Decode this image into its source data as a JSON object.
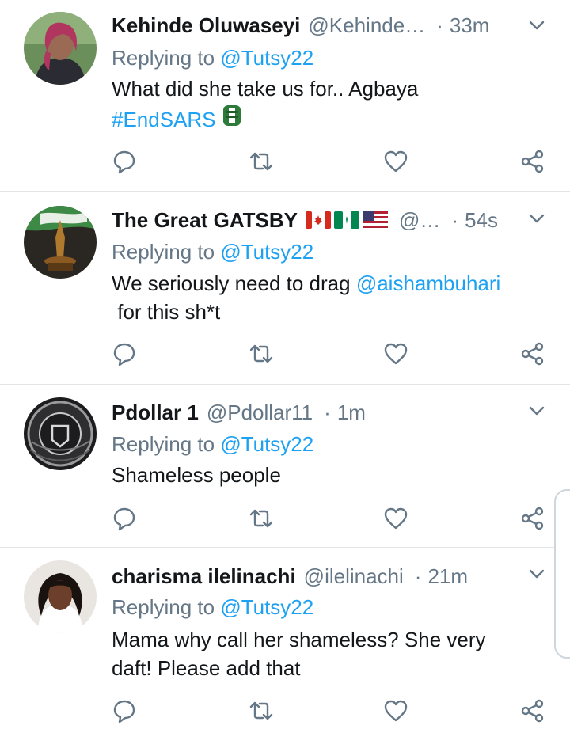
{
  "tweets": [
    {
      "name": "Kehinde Oluwaseyi",
      "handle": "@Kehinde…",
      "separator": "·",
      "time": "33m",
      "reply_prefix": "Replying to",
      "reply_to": "@Tutsy22",
      "line1": "What did she take us for..  Agbaya",
      "hashtag": "#EndSARS",
      "emoji": "fist-flag-emoji"
    },
    {
      "name": "The Great GATSBY",
      "flags": [
        "canada-flag",
        "nigeria-flag",
        "usa-flag"
      ],
      "handle": "@…",
      "separator": "·",
      "time": "54s",
      "reply_prefix": "Replying to",
      "reply_to": "@Tutsy22",
      "line1_pre": "We seriously need to drag ",
      "mention": "@aishambuhari",
      "line2": " for this sh*t"
    },
    {
      "name": "Pdollar 1",
      "handle": "@Pdollar11",
      "separator": "·",
      "time": "1m",
      "reply_prefix": "Replying to",
      "reply_to": "@Tutsy22",
      "line1": "Shameless people"
    },
    {
      "name": "charisma ilelinachi",
      "handle": "@ilelinachi",
      "separator": "·",
      "time": "21m",
      "reply_prefix": "Replying to",
      "reply_to": "@Tutsy22",
      "line1": "Mama why call her shameless? She very",
      "line2": "daft! Please add that"
    }
  ],
  "icons": {
    "reply": "reply-bubble-icon",
    "retweet": "retweet-icon",
    "like": "heart-icon",
    "share": "share-icon",
    "more": "chevron-down-icon"
  },
  "colors": {
    "accent": "#1da1f2",
    "secondary_text": "#657786",
    "primary_text": "#14171a",
    "divider": "#e3e6e8"
  }
}
